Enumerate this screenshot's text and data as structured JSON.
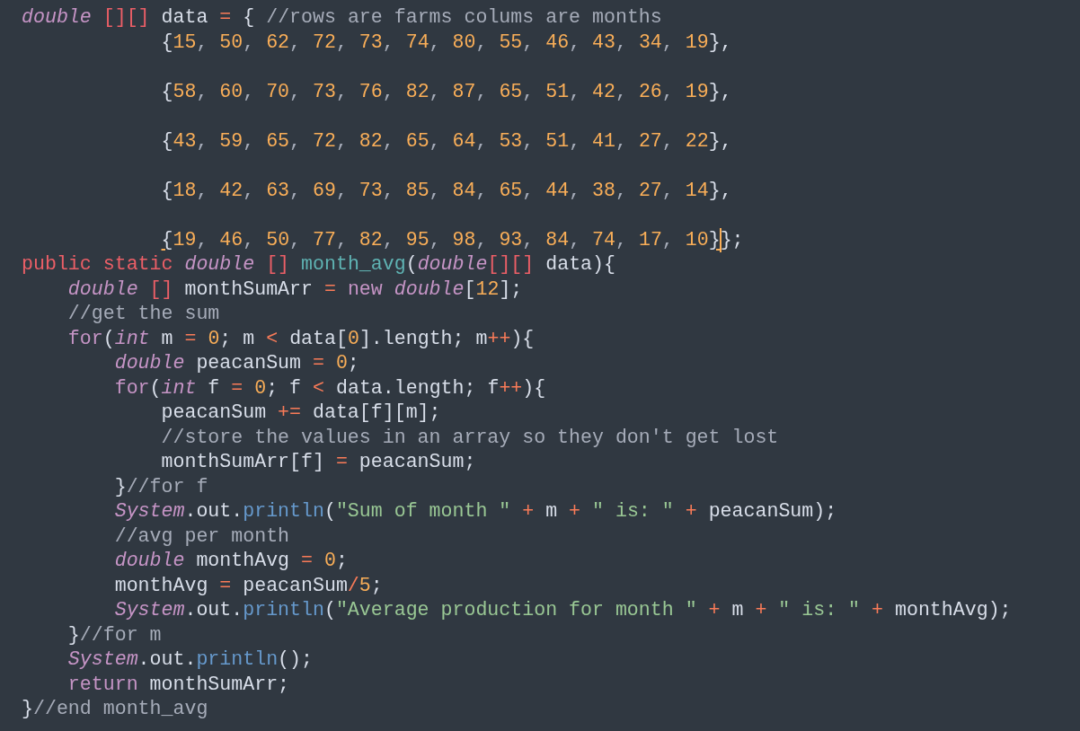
{
  "editor": {
    "lines": [
      {
        "blank_after": false,
        "tokens": [
          {
            "kind": "type",
            "text": "double"
          },
          {
            "kind": "storage",
            "text": " [][]"
          },
          {
            "kind": "plain",
            "text": " data "
          },
          {
            "kind": "operator",
            "text": "="
          },
          {
            "kind": "plain",
            "text": " { "
          },
          {
            "kind": "comment",
            "text": "//rows are farms colums are months"
          }
        ]
      },
      {
        "blank_after": true,
        "tokens": [
          {
            "kind": "plain",
            "text": "            {"
          },
          {
            "kind": "number",
            "text": "15"
          },
          {
            "kind": "punctuation",
            "text": ", "
          },
          {
            "kind": "number",
            "text": "50"
          },
          {
            "kind": "punctuation",
            "text": ", "
          },
          {
            "kind": "number",
            "text": "62"
          },
          {
            "kind": "punctuation",
            "text": ", "
          },
          {
            "kind": "number",
            "text": "72"
          },
          {
            "kind": "punctuation",
            "text": ", "
          },
          {
            "kind": "number",
            "text": "73"
          },
          {
            "kind": "punctuation",
            "text": ", "
          },
          {
            "kind": "number",
            "text": "74"
          },
          {
            "kind": "punctuation",
            "text": ", "
          },
          {
            "kind": "number",
            "text": "80"
          },
          {
            "kind": "punctuation",
            "text": ", "
          },
          {
            "kind": "number",
            "text": "55"
          },
          {
            "kind": "punctuation",
            "text": ", "
          },
          {
            "kind": "number",
            "text": "46"
          },
          {
            "kind": "punctuation",
            "text": ", "
          },
          {
            "kind": "number",
            "text": "43"
          },
          {
            "kind": "punctuation",
            "text": ", "
          },
          {
            "kind": "number",
            "text": "34"
          },
          {
            "kind": "punctuation",
            "text": ", "
          },
          {
            "kind": "number",
            "text": "19"
          },
          {
            "kind": "plain",
            "text": "},"
          }
        ]
      },
      {
        "blank_after": true,
        "tokens": [
          {
            "kind": "plain",
            "text": "            {"
          },
          {
            "kind": "number",
            "text": "58"
          },
          {
            "kind": "punctuation",
            "text": ", "
          },
          {
            "kind": "number",
            "text": "60"
          },
          {
            "kind": "punctuation",
            "text": ", "
          },
          {
            "kind": "number",
            "text": "70"
          },
          {
            "kind": "punctuation",
            "text": ", "
          },
          {
            "kind": "number",
            "text": "73"
          },
          {
            "kind": "punctuation",
            "text": ", "
          },
          {
            "kind": "number",
            "text": "76"
          },
          {
            "kind": "punctuation",
            "text": ", "
          },
          {
            "kind": "number",
            "text": "82"
          },
          {
            "kind": "punctuation",
            "text": ", "
          },
          {
            "kind": "number",
            "text": "87"
          },
          {
            "kind": "punctuation",
            "text": ", "
          },
          {
            "kind": "number",
            "text": "65"
          },
          {
            "kind": "punctuation",
            "text": ", "
          },
          {
            "kind": "number",
            "text": "51"
          },
          {
            "kind": "punctuation",
            "text": ", "
          },
          {
            "kind": "number",
            "text": "42"
          },
          {
            "kind": "punctuation",
            "text": ", "
          },
          {
            "kind": "number",
            "text": "26"
          },
          {
            "kind": "punctuation",
            "text": ", "
          },
          {
            "kind": "number",
            "text": "19"
          },
          {
            "kind": "plain",
            "text": "},"
          }
        ]
      },
      {
        "blank_after": true,
        "tokens": [
          {
            "kind": "plain",
            "text": "            {"
          },
          {
            "kind": "number",
            "text": "43"
          },
          {
            "kind": "punctuation",
            "text": ", "
          },
          {
            "kind": "number",
            "text": "59"
          },
          {
            "kind": "punctuation",
            "text": ", "
          },
          {
            "kind": "number",
            "text": "65"
          },
          {
            "kind": "punctuation",
            "text": ", "
          },
          {
            "kind": "number",
            "text": "72"
          },
          {
            "kind": "punctuation",
            "text": ", "
          },
          {
            "kind": "number",
            "text": "82"
          },
          {
            "kind": "punctuation",
            "text": ", "
          },
          {
            "kind": "number",
            "text": "65"
          },
          {
            "kind": "punctuation",
            "text": ", "
          },
          {
            "kind": "number",
            "text": "64"
          },
          {
            "kind": "punctuation",
            "text": ", "
          },
          {
            "kind": "number",
            "text": "53"
          },
          {
            "kind": "punctuation",
            "text": ", "
          },
          {
            "kind": "number",
            "text": "51"
          },
          {
            "kind": "punctuation",
            "text": ", "
          },
          {
            "kind": "number",
            "text": "41"
          },
          {
            "kind": "punctuation",
            "text": ", "
          },
          {
            "kind": "number",
            "text": "27"
          },
          {
            "kind": "punctuation",
            "text": ", "
          },
          {
            "kind": "number",
            "text": "22"
          },
          {
            "kind": "plain",
            "text": "},"
          }
        ]
      },
      {
        "blank_after": true,
        "tokens": [
          {
            "kind": "plain",
            "text": "            {"
          },
          {
            "kind": "number",
            "text": "18"
          },
          {
            "kind": "punctuation",
            "text": ", "
          },
          {
            "kind": "number",
            "text": "42"
          },
          {
            "kind": "punctuation",
            "text": ", "
          },
          {
            "kind": "number",
            "text": "63"
          },
          {
            "kind": "punctuation",
            "text": ", "
          },
          {
            "kind": "number",
            "text": "69"
          },
          {
            "kind": "punctuation",
            "text": ", "
          },
          {
            "kind": "number",
            "text": "73"
          },
          {
            "kind": "punctuation",
            "text": ", "
          },
          {
            "kind": "number",
            "text": "85"
          },
          {
            "kind": "punctuation",
            "text": ", "
          },
          {
            "kind": "number",
            "text": "84"
          },
          {
            "kind": "punctuation",
            "text": ", "
          },
          {
            "kind": "number",
            "text": "65"
          },
          {
            "kind": "punctuation",
            "text": ", "
          },
          {
            "kind": "number",
            "text": "44"
          },
          {
            "kind": "punctuation",
            "text": ", "
          },
          {
            "kind": "number",
            "text": "38"
          },
          {
            "kind": "punctuation",
            "text": ", "
          },
          {
            "kind": "number",
            "text": "27"
          },
          {
            "kind": "punctuation",
            "text": ", "
          },
          {
            "kind": "number",
            "text": "14"
          },
          {
            "kind": "plain",
            "text": "},"
          }
        ]
      },
      {
        "blank_after": false,
        "tokens": [
          {
            "kind": "bracket-match",
            "text": "            {"
          },
          {
            "kind": "number",
            "text": "19"
          },
          {
            "kind": "punctuation",
            "text": ", "
          },
          {
            "kind": "number",
            "text": "46"
          },
          {
            "kind": "punctuation",
            "text": ", "
          },
          {
            "kind": "number",
            "text": "50"
          },
          {
            "kind": "punctuation",
            "text": ", "
          },
          {
            "kind": "number",
            "text": "77"
          },
          {
            "kind": "punctuation",
            "text": ", "
          },
          {
            "kind": "number",
            "text": "82"
          },
          {
            "kind": "punctuation",
            "text": ", "
          },
          {
            "kind": "number",
            "text": "95"
          },
          {
            "kind": "punctuation",
            "text": ", "
          },
          {
            "kind": "number",
            "text": "98"
          },
          {
            "kind": "punctuation",
            "text": ", "
          },
          {
            "kind": "number",
            "text": "93"
          },
          {
            "kind": "punctuation",
            "text": ", "
          },
          {
            "kind": "number",
            "text": "84"
          },
          {
            "kind": "punctuation",
            "text": ", "
          },
          {
            "kind": "number",
            "text": "74"
          },
          {
            "kind": "punctuation",
            "text": ", "
          },
          {
            "kind": "number",
            "text": "17"
          },
          {
            "kind": "punctuation",
            "text": ", "
          },
          {
            "kind": "number",
            "text": "10"
          },
          {
            "kind": "bracket-match-caret",
            "text": "}"
          },
          {
            "kind": "plain",
            "text": "};"
          }
        ]
      },
      {
        "blank_after": false,
        "tokens": [
          {
            "kind": "storage",
            "text": "public"
          },
          {
            "kind": "storage",
            "text": " static"
          },
          {
            "kind": "type",
            "text": " double"
          },
          {
            "kind": "storage",
            "text": " []"
          },
          {
            "kind": "function",
            "text": " month_avg"
          },
          {
            "kind": "plain",
            "text": "("
          },
          {
            "kind": "type",
            "text": "double"
          },
          {
            "kind": "storage",
            "text": "[][]"
          },
          {
            "kind": "plain",
            "text": " data){"
          }
        ]
      },
      {
        "blank_after": false,
        "tokens": [
          {
            "kind": "type",
            "text": "    double"
          },
          {
            "kind": "storage",
            "text": " []"
          },
          {
            "kind": "plain",
            "text": " monthSumArr "
          },
          {
            "kind": "operator",
            "text": "="
          },
          {
            "kind": "keyword",
            "text": " new"
          },
          {
            "kind": "type",
            "text": " double"
          },
          {
            "kind": "plain",
            "text": "["
          },
          {
            "kind": "number",
            "text": "12"
          },
          {
            "kind": "plain",
            "text": "];"
          }
        ]
      },
      {
        "blank_after": false,
        "tokens": [
          {
            "kind": "comment",
            "text": "    //get the sum"
          }
        ]
      },
      {
        "blank_after": false,
        "tokens": [
          {
            "kind": "keyword",
            "text": "    for"
          },
          {
            "kind": "plain",
            "text": "("
          },
          {
            "kind": "type",
            "text": "int"
          },
          {
            "kind": "plain",
            "text": " m "
          },
          {
            "kind": "operator",
            "text": "="
          },
          {
            "kind": "number",
            "text": " 0"
          },
          {
            "kind": "plain",
            "text": "; m "
          },
          {
            "kind": "operator",
            "text": "<"
          },
          {
            "kind": "plain",
            "text": " data["
          },
          {
            "kind": "number",
            "text": "0"
          },
          {
            "kind": "plain",
            "text": "].length; m"
          },
          {
            "kind": "operator",
            "text": "++"
          },
          {
            "kind": "plain",
            "text": "){"
          }
        ]
      },
      {
        "blank_after": false,
        "tokens": [
          {
            "kind": "type",
            "text": "        double"
          },
          {
            "kind": "plain",
            "text": " peacanSum "
          },
          {
            "kind": "operator",
            "text": "="
          },
          {
            "kind": "number",
            "text": " 0"
          },
          {
            "kind": "plain",
            "text": ";"
          }
        ]
      },
      {
        "blank_after": false,
        "tokens": [
          {
            "kind": "keyword",
            "text": "        for"
          },
          {
            "kind": "plain",
            "text": "("
          },
          {
            "kind": "type",
            "text": "int"
          },
          {
            "kind": "plain",
            "text": " f "
          },
          {
            "kind": "operator",
            "text": "="
          },
          {
            "kind": "number",
            "text": " 0"
          },
          {
            "kind": "plain",
            "text": "; f "
          },
          {
            "kind": "operator",
            "text": "<"
          },
          {
            "kind": "plain",
            "text": " data.length; f"
          },
          {
            "kind": "operator",
            "text": "++"
          },
          {
            "kind": "plain",
            "text": "){"
          }
        ]
      },
      {
        "blank_after": false,
        "tokens": [
          {
            "kind": "plain",
            "text": "            peacanSum "
          },
          {
            "kind": "operator",
            "text": "+="
          },
          {
            "kind": "plain",
            "text": " data[f][m];"
          }
        ]
      },
      {
        "blank_after": false,
        "tokens": [
          {
            "kind": "comment",
            "text": "            //store the values in an array so they don't get lost"
          }
        ]
      },
      {
        "blank_after": false,
        "tokens": [
          {
            "kind": "plain",
            "text": "            monthSumArr[f] "
          },
          {
            "kind": "operator",
            "text": "="
          },
          {
            "kind": "plain",
            "text": " peacanSum;"
          }
        ]
      },
      {
        "blank_after": false,
        "tokens": [
          {
            "kind": "plain",
            "text": "        }"
          },
          {
            "kind": "comment",
            "text": "//for f"
          }
        ]
      },
      {
        "blank_after": false,
        "tokens": [
          {
            "kind": "type",
            "text": "        System"
          },
          {
            "kind": "plain",
            "text": ".out."
          },
          {
            "kind": "method",
            "text": "println"
          },
          {
            "kind": "plain",
            "text": "("
          },
          {
            "kind": "string",
            "text": "\"Sum of month \""
          },
          {
            "kind": "operator",
            "text": " +"
          },
          {
            "kind": "plain",
            "text": " m "
          },
          {
            "kind": "operator",
            "text": "+"
          },
          {
            "kind": "string",
            "text": " \" is: \""
          },
          {
            "kind": "operator",
            "text": " +"
          },
          {
            "kind": "plain",
            "text": " peacanSum);"
          }
        ]
      },
      {
        "blank_after": false,
        "tokens": [
          {
            "kind": "comment",
            "text": "        //avg per month"
          }
        ]
      },
      {
        "blank_after": false,
        "tokens": [
          {
            "kind": "type",
            "text": "        double"
          },
          {
            "kind": "plain",
            "text": " monthAvg "
          },
          {
            "kind": "operator",
            "text": "="
          },
          {
            "kind": "number",
            "text": " 0"
          },
          {
            "kind": "plain",
            "text": ";"
          }
        ]
      },
      {
        "blank_after": false,
        "tokens": [
          {
            "kind": "plain",
            "text": "        monthAvg "
          },
          {
            "kind": "operator",
            "text": "="
          },
          {
            "kind": "plain",
            "text": " peacanSum"
          },
          {
            "kind": "operator",
            "text": "/"
          },
          {
            "kind": "number",
            "text": "5"
          },
          {
            "kind": "plain",
            "text": ";"
          }
        ]
      },
      {
        "blank_after": false,
        "tokens": [
          {
            "kind": "type",
            "text": "        System"
          },
          {
            "kind": "plain",
            "text": ".out."
          },
          {
            "kind": "method",
            "text": "println"
          },
          {
            "kind": "plain",
            "text": "("
          },
          {
            "kind": "string",
            "text": "\"Average production for month \""
          },
          {
            "kind": "operator",
            "text": " +"
          },
          {
            "kind": "plain",
            "text": " m "
          },
          {
            "kind": "operator",
            "text": "+"
          },
          {
            "kind": "string",
            "text": " \" is: \""
          },
          {
            "kind": "operator",
            "text": " +"
          },
          {
            "kind": "plain",
            "text": " monthAvg);"
          }
        ]
      },
      {
        "blank_after": false,
        "tokens": [
          {
            "kind": "plain",
            "text": "    }"
          },
          {
            "kind": "comment",
            "text": "//for m"
          }
        ]
      },
      {
        "blank_after": false,
        "tokens": [
          {
            "kind": "type",
            "text": "    System"
          },
          {
            "kind": "plain",
            "text": ".out."
          },
          {
            "kind": "method",
            "text": "println"
          },
          {
            "kind": "plain",
            "text": "();"
          }
        ]
      },
      {
        "blank_after": false,
        "tokens": [
          {
            "kind": "keyword",
            "text": "    return"
          },
          {
            "kind": "plain",
            "text": " monthSumArr;"
          }
        ]
      },
      {
        "blank_after": false,
        "tokens": [
          {
            "kind": "plain",
            "text": "}"
          },
          {
            "kind": "comment",
            "text": "//end month_avg"
          }
        ]
      }
    ]
  }
}
